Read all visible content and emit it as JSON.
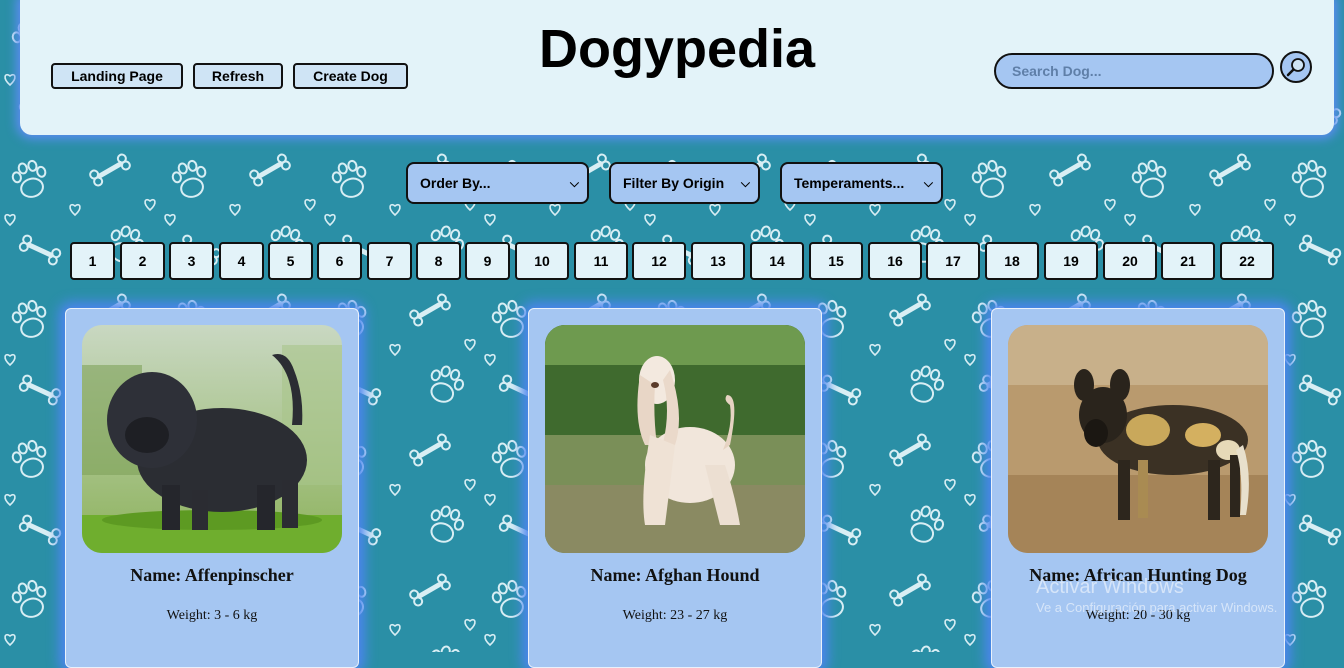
{
  "header": {
    "title": "Dogypedia",
    "buttons": {
      "landing": "Landing Page",
      "refresh": "Refresh",
      "create": "Create Dog"
    },
    "search": {
      "placeholder": "Search Dog..."
    }
  },
  "filters": {
    "order": "Order By...",
    "origin": "Filter By Origin",
    "temperaments": "Temperaments..."
  },
  "pagination": [
    "1",
    "2",
    "3",
    "4",
    "5",
    "6",
    "7",
    "8",
    "9",
    "10",
    "11",
    "12",
    "13",
    "14",
    "15",
    "16",
    "17",
    "18",
    "19",
    "20",
    "21",
    "22"
  ],
  "cards": [
    {
      "name": "Name: Affenpinscher",
      "weight": "Weight: 3 - 6 kg"
    },
    {
      "name": "Name: Afghan Hound",
      "weight": "Weight: 23 - 27 kg"
    },
    {
      "name": "Name: African Hunting Dog",
      "weight": "Weight: 20 - 30 kg"
    }
  ],
  "watermark": {
    "line1": "Activar Windows",
    "line2": "Ve a Configuración para activar Windows."
  },
  "colors": {
    "background": "#2a8fa6",
    "header": "#e3f3f9",
    "card": "#a5c6f2",
    "glow": "#4d85ef"
  }
}
